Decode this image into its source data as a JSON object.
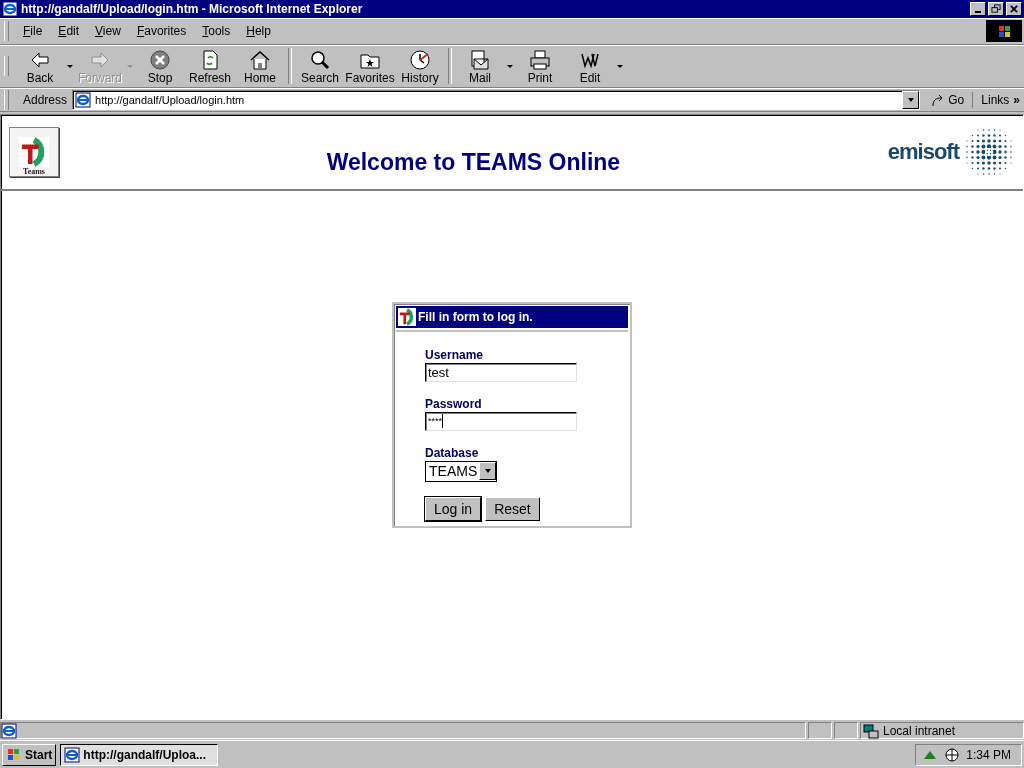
{
  "window": {
    "title": "http://gandalf/Upload/login.htm - Microsoft Internet Explorer"
  },
  "menu": [
    "File",
    "Edit",
    "View",
    "Favorites",
    "Tools",
    "Help"
  ],
  "toolbar": [
    {
      "label": "Back",
      "kind": "back",
      "disabled": false,
      "dropdown": true
    },
    {
      "label": "Forward",
      "kind": "forward",
      "disabled": true,
      "dropdown": true
    },
    {
      "label": "Stop",
      "kind": "stop",
      "disabled": false,
      "dropdown": false
    },
    {
      "label": "Refresh",
      "kind": "refresh",
      "disabled": false,
      "dropdown": false
    },
    {
      "label": "Home",
      "kind": "home",
      "disabled": false,
      "dropdown": false
    },
    {
      "kind": "separator"
    },
    {
      "label": "Search",
      "kind": "search",
      "disabled": false,
      "dropdown": false
    },
    {
      "label": "Favorites",
      "kind": "favorites",
      "disabled": false,
      "dropdown": false
    },
    {
      "label": "History",
      "kind": "history",
      "disabled": false,
      "dropdown": false
    },
    {
      "kind": "separator"
    },
    {
      "label": "Mail",
      "kind": "mail",
      "disabled": false,
      "dropdown": true
    },
    {
      "label": "Print",
      "kind": "print",
      "disabled": false,
      "dropdown": false
    },
    {
      "label": "Edit",
      "kind": "edit",
      "disabled": false,
      "dropdown": true
    }
  ],
  "address": {
    "label": "Address",
    "value": "http://gandalf/Upload/login.htm",
    "go": "Go",
    "links": "Links",
    "more": "»"
  },
  "page": {
    "logo_text": "Teams",
    "heading": "Welcome to TEAMS Online",
    "brand": "emisoft",
    "login": {
      "title": "Fill in form to log in.",
      "fields": [
        {
          "label": "Username",
          "kind": "text",
          "value": "test"
        },
        {
          "label": "Password",
          "kind": "password",
          "value": "****"
        },
        {
          "label": "Database",
          "kind": "select",
          "value": "TEAMS"
        }
      ],
      "buttons": [
        "Log in",
        "Reset"
      ]
    }
  },
  "status_bar": {
    "zone": "Local intranet"
  },
  "taskbar": {
    "start": "Start",
    "tasks": [
      {
        "label": "http://gandalf/Uploa...",
        "selected": true
      }
    ],
    "clock": "1:34 PM"
  }
}
